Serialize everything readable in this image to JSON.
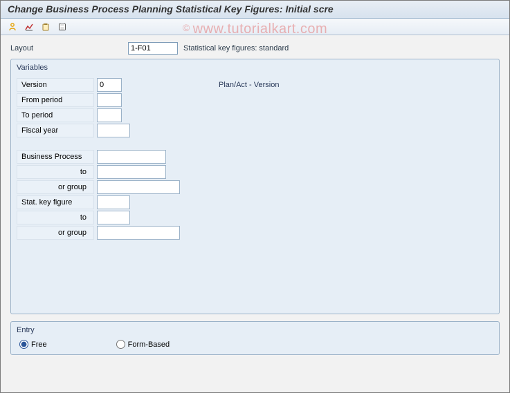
{
  "watermark": "www.tutorialkart.com",
  "header": {
    "title": "Change Business Process Planning Statistical Key Figures: Initial scre"
  },
  "toolbar": {
    "icons": [
      "person-icon",
      "chart-icon",
      "paste-icon",
      "save-icon"
    ]
  },
  "layout": {
    "label": "Layout",
    "value": "1-F01",
    "description": "Statistical key figures: standard"
  },
  "variables": {
    "title": "Variables",
    "version": {
      "label": "Version",
      "value": "0",
      "description": "Plan/Act - Version"
    },
    "from_period": {
      "label": "From period",
      "value": ""
    },
    "to_period": {
      "label": "To period",
      "value": ""
    },
    "fiscal_year": {
      "label": "Fiscal year",
      "value": ""
    },
    "business_process": {
      "label": "Business Process",
      "value": ""
    },
    "bp_to": {
      "label": "to",
      "value": ""
    },
    "bp_group": {
      "label": "or group",
      "value": ""
    },
    "stat_key_figure": {
      "label": "Stat. key figure",
      "value": ""
    },
    "skf_to": {
      "label": "to",
      "value": ""
    },
    "skf_group": {
      "label": "or group",
      "value": ""
    }
  },
  "entry": {
    "title": "Entry",
    "free": "Free",
    "form_based": "Form-Based",
    "selected": "free"
  }
}
